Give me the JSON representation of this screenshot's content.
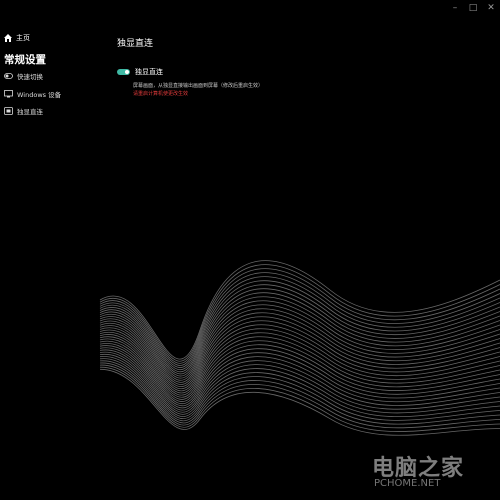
{
  "window": {
    "controls": [
      "–",
      "□",
      "✕"
    ]
  },
  "sidebar": {
    "home_label": "主页",
    "section_title": "常规设置",
    "items": [
      {
        "label": "快速切换",
        "icon": "toggle-icon"
      },
      {
        "label": "Windows 设备",
        "icon": "windows-device-icon"
      },
      {
        "label": "独显直连",
        "icon": "gpu-direct-icon"
      }
    ]
  },
  "main": {
    "page_title": "独显直连",
    "setting": {
      "label": "独显直连",
      "enabled": true,
      "description": "屏幕画面，从独显直接输出画面到屏幕（修改后重启生效）",
      "warning": "请重启计算机使更改生效"
    }
  },
  "colors": {
    "background": "#000000",
    "toggle_on": "#3fb9a4",
    "warning": "#e23b3b"
  },
  "watermark": {
    "text": "电脑之家",
    "sub": "PCHOME.NET"
  }
}
